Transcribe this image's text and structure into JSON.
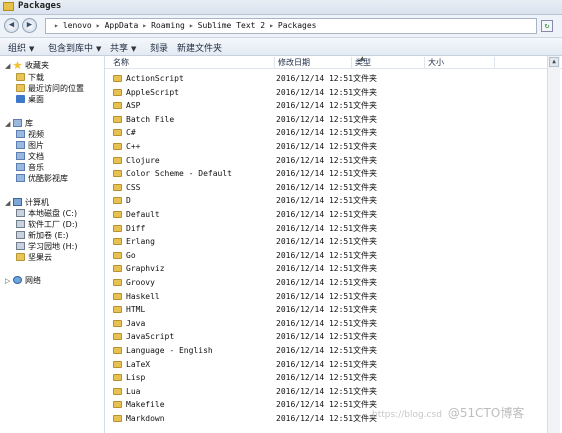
{
  "window": {
    "title": "Packages"
  },
  "address": {
    "segments": [
      "lenovo",
      "AppData",
      "Roaming",
      "Sublime Text 2",
      "Packages"
    ],
    "separator": "▸"
  },
  "toolbar": {
    "organize": "组织",
    "include_library": "包含到库中",
    "share": "共享",
    "burn": "刻录",
    "new_folder": "新建文件夹"
  },
  "nav": {
    "favorites": {
      "label": "收藏夹",
      "items": [
        "下载",
        "最近访问的位置",
        "桌面"
      ]
    },
    "libraries": {
      "label": "库",
      "items": [
        "视频",
        "图片",
        "文档",
        "音乐",
        "优酷影视库"
      ]
    },
    "computer": {
      "label": "计算机",
      "items": [
        "本地磁盘 (C:)",
        "软件工厂 (D:)",
        "新加卷 (E:)",
        "学习园地 (H:)",
        "坚果云"
      ]
    },
    "network": {
      "label": "网络"
    }
  },
  "columns": {
    "name": "名称",
    "date": "修改日期",
    "type": "类型",
    "size": "大小"
  },
  "files": [
    {
      "name": "ActionScript",
      "date": "2016/12/14 12:51",
      "type": "文件夹"
    },
    {
      "name": "AppleScript",
      "date": "2016/12/14 12:51",
      "type": "文件夹"
    },
    {
      "name": "ASP",
      "date": "2016/12/14 12:51",
      "type": "文件夹"
    },
    {
      "name": "Batch File",
      "date": "2016/12/14 12:51",
      "type": "文件夹"
    },
    {
      "name": "C#",
      "date": "2016/12/14 12:51",
      "type": "文件夹"
    },
    {
      "name": "C++",
      "date": "2016/12/14 12:51",
      "type": "文件夹"
    },
    {
      "name": "Clojure",
      "date": "2016/12/14 12:51",
      "type": "文件夹"
    },
    {
      "name": "Color Scheme - Default",
      "date": "2016/12/14 12:51",
      "type": "文件夹"
    },
    {
      "name": "CSS",
      "date": "2016/12/14 12:51",
      "type": "文件夹"
    },
    {
      "name": "D",
      "date": "2016/12/14 12:51",
      "type": "文件夹"
    },
    {
      "name": "Default",
      "date": "2016/12/14 12:51",
      "type": "文件夹"
    },
    {
      "name": "Diff",
      "date": "2016/12/14 12:51",
      "type": "文件夹"
    },
    {
      "name": "Erlang",
      "date": "2016/12/14 12:51",
      "type": "文件夹"
    },
    {
      "name": "Go",
      "date": "2016/12/14 12:51",
      "type": "文件夹"
    },
    {
      "name": "Graphviz",
      "date": "2016/12/14 12:51",
      "type": "文件夹"
    },
    {
      "name": "Groovy",
      "date": "2016/12/14 12:51",
      "type": "文件夹"
    },
    {
      "name": "Haskell",
      "date": "2016/12/14 12:51",
      "type": "文件夹"
    },
    {
      "name": "HTML",
      "date": "2016/12/14 12:51",
      "type": "文件夹"
    },
    {
      "name": "Java",
      "date": "2016/12/14 12:51",
      "type": "文件夹"
    },
    {
      "name": "JavaScript",
      "date": "2016/12/14 12:51",
      "type": "文件夹"
    },
    {
      "name": "Language - English",
      "date": "2016/12/14 12:51",
      "type": "文件夹"
    },
    {
      "name": "LaTeX",
      "date": "2016/12/14 12:51",
      "type": "文件夹"
    },
    {
      "name": "Lisp",
      "date": "2016/12/14 12:51",
      "type": "文件夹"
    },
    {
      "name": "Lua",
      "date": "2016/12/14 12:51",
      "type": "文件夹"
    },
    {
      "name": "Makefile",
      "date": "2016/12/14 12:51",
      "type": "文件夹"
    },
    {
      "name": "Markdown",
      "date": "2016/12/14 12:51",
      "type": "文件夹"
    }
  ],
  "watermark": {
    "left": "https://blog.csd",
    "right": "@51CTO博客"
  }
}
